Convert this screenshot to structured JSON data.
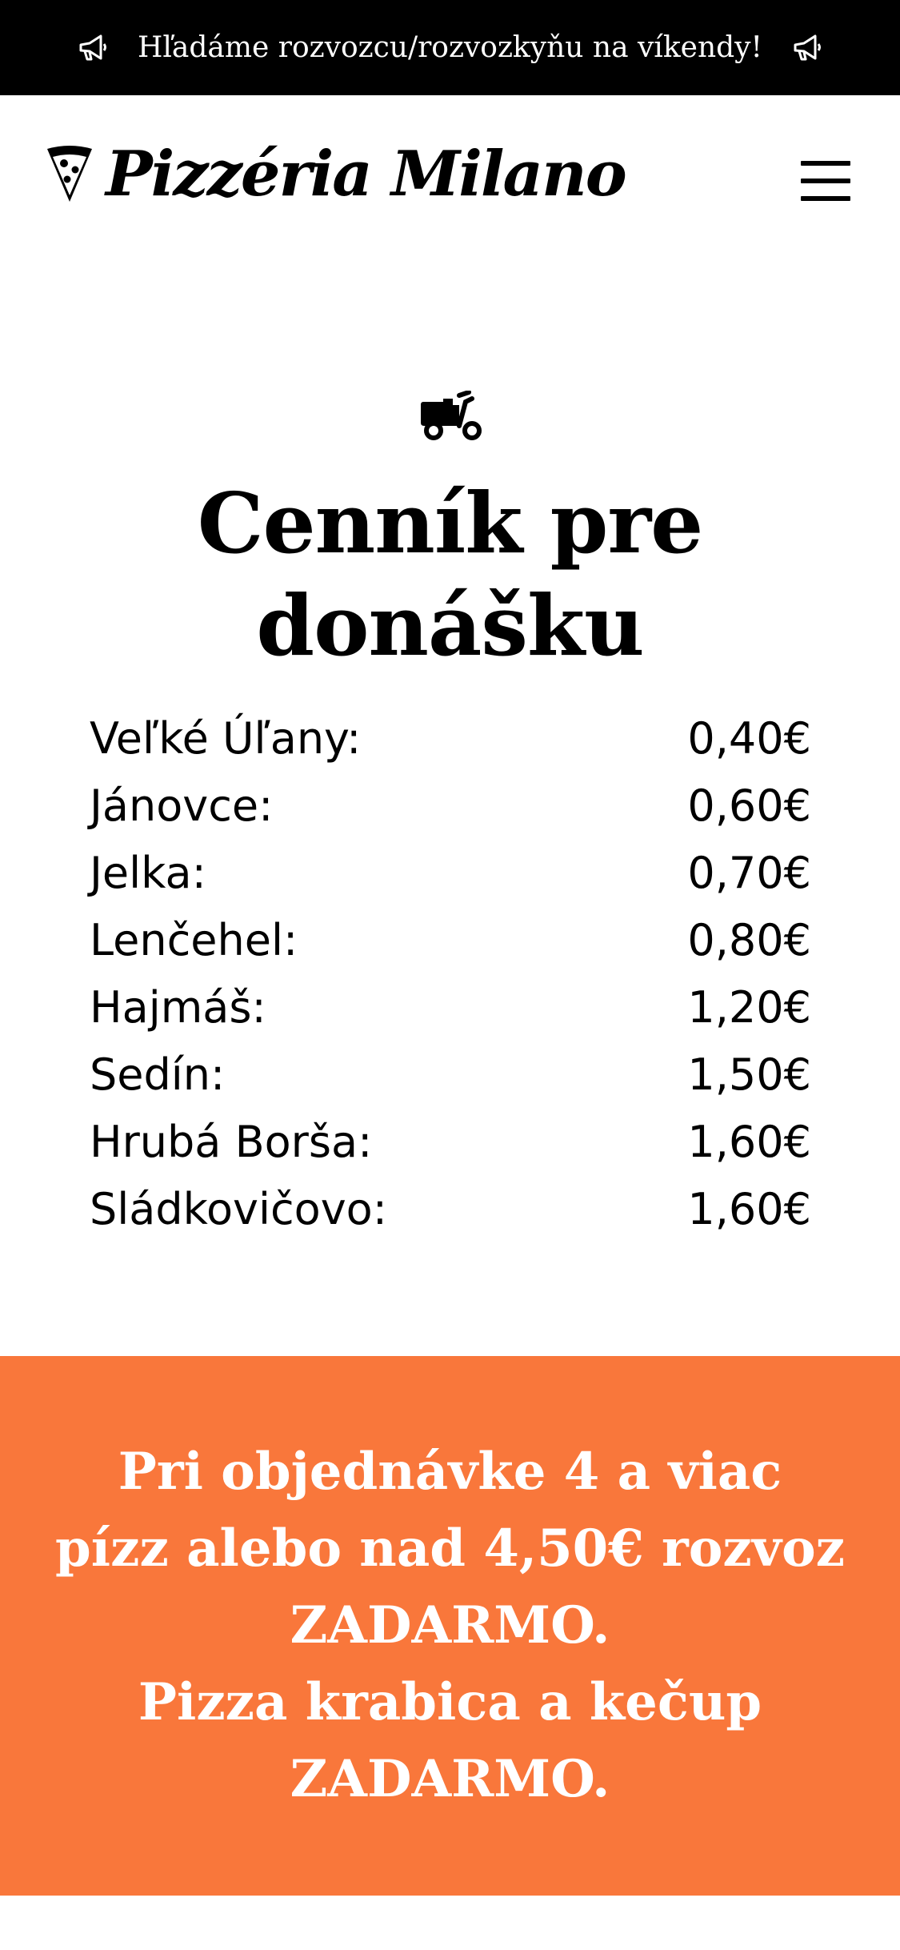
{
  "announcement": {
    "text": "Hľadáme rozvozcu/rozvozkyňu na víkendy!",
    "icon": "megaphone-icon"
  },
  "header": {
    "logo_text": "Pizzéria Milano",
    "logo_icon": "pizza-slice-icon",
    "menu_icon": "hamburger-menu-icon"
  },
  "delivery": {
    "icon": "scooter-icon",
    "title_line1": "Cenník pre",
    "title_line2": "donášku",
    "items": [
      {
        "place": "Veľké Úľany:",
        "price": "0,40€"
      },
      {
        "place": "Jánovce:",
        "price": "0,60€"
      },
      {
        "place": "Jelka:",
        "price": "0,70€"
      },
      {
        "place": "Lenčehel:",
        "price": "0,80€"
      },
      {
        "place": "Hajmáš:",
        "price": "1,20€"
      },
      {
        "place": "Sedín:",
        "price": "1,50€"
      },
      {
        "place": "Hrubá Borša:",
        "price": "1,60€"
      },
      {
        "place": "Sládkovičovo:",
        "price": "1,60€"
      }
    ]
  },
  "promo": {
    "lines": [
      "Pri objednávke 4 a viac",
      "pízz alebo nad 4,50€ rozvoz",
      "ZADARMO.",
      "Pizza krabica a kečup",
      "ZADARMO."
    ]
  },
  "colors": {
    "topbar_bg": "#000000",
    "promo_bg": "#f9773b",
    "text": "#000000",
    "promo_text": "#ffffff"
  }
}
